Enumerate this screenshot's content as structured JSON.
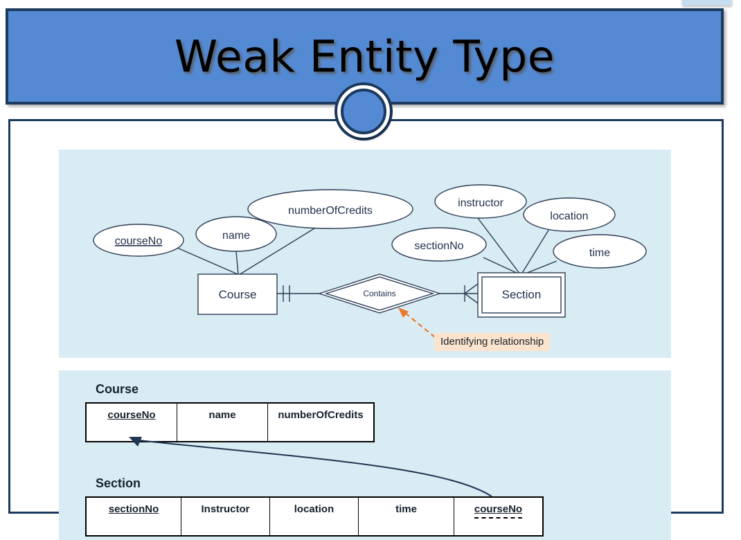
{
  "slide": {
    "title": "Weak Entity Type",
    "banner_color": "#548ad4",
    "banner_border_color": "#1b3a5e",
    "panel_color": "#d9ecf3",
    "callout_color": "#fce3cd",
    "accent_orange": "#e8762c"
  },
  "er_diagram": {
    "entities": [
      {
        "name": "Course",
        "weak": false
      },
      {
        "name": "Section",
        "weak": true
      }
    ],
    "relationship": {
      "name": "Contains",
      "identifying": true,
      "cardinality_left": "one",
      "cardinality_right": "many"
    },
    "course_attributes": [
      {
        "label": "courseNo",
        "key": true
      },
      {
        "label": "name",
        "key": false
      },
      {
        "label": "numberOfCredits",
        "key": false
      }
    ],
    "section_attributes": [
      {
        "label": "sectionNo",
        "key": false
      },
      {
        "label": "instructor",
        "key": false
      },
      {
        "label": "location",
        "key": false
      },
      {
        "label": "time",
        "key": false
      }
    ],
    "annotation": "Identifying relationship"
  },
  "relations": {
    "course": {
      "title": "Course",
      "columns": [
        {
          "label": "courseNo",
          "key": "pk"
        },
        {
          "label": "name",
          "key": ""
        },
        {
          "label": "numberOfCredits",
          "key": ""
        }
      ]
    },
    "section": {
      "title": "Section",
      "columns": [
        {
          "label": "sectionNo",
          "key": "pk"
        },
        {
          "label": "Instructor",
          "key": ""
        },
        {
          "label": "location",
          "key": ""
        },
        {
          "label": "time",
          "key": ""
        },
        {
          "label": "courseNo",
          "key": "pk-fk"
        }
      ]
    }
  }
}
